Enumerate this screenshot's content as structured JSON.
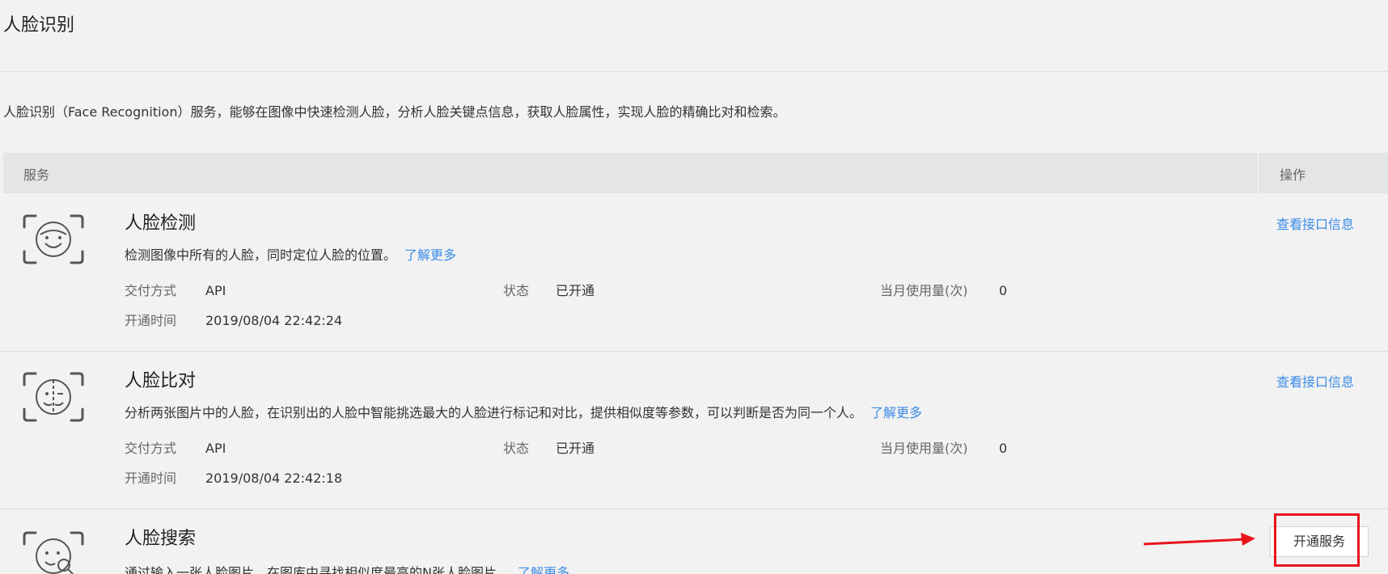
{
  "header": {
    "title": "人脸识别",
    "description": "人脸识别（Face Recognition）服务，能够在图像中快速检测人脸，分析人脸关键点信息，获取人脸属性，实现人脸的精确比对和检索。"
  },
  "table": {
    "col_service": "服务",
    "col_action": "操作"
  },
  "services": [
    {
      "name": "人脸检测",
      "icon": "face-smile-icon",
      "desc": "检测图像中所有的人脸，同时定位人脸的位置。",
      "more": "了解更多",
      "delivery_label": "交付方式",
      "delivery_value": "API",
      "status_label": "状态",
      "status_value": "已开通",
      "usage_label": "当月使用量(次)",
      "usage_value": "0",
      "open_time_label": "开通时间",
      "open_time_value": "2019/08/04 22:42:24",
      "action": "查看接口信息"
    },
    {
      "name": "人脸比对",
      "icon": "face-compare-icon",
      "desc": "分析两张图片中的人脸，在识别出的人脸中智能挑选最大的人脸进行标记和对比，提供相似度等参数，可以判断是否为同一个人。",
      "more": "了解更多",
      "delivery_label": "交付方式",
      "delivery_value": "API",
      "status_label": "状态",
      "status_value": "已开通",
      "usage_label": "当月使用量(次)",
      "usage_value": "0",
      "open_time_label": "开通时间",
      "open_time_value": "2019/08/04 22:42:18",
      "action": "查看接口信息"
    },
    {
      "name": "人脸搜索",
      "icon": "face-search-icon",
      "desc": "通过输入一张人脸图片，在图库中寻找相似度最高的N张人脸图片。",
      "more": "了解更多",
      "action": "开通服务"
    }
  ],
  "colors": {
    "link": "#3b8be8",
    "annotation": "#e8141b",
    "header_bg": "#e3e5e6",
    "page_bg": "#f2f2f2"
  }
}
